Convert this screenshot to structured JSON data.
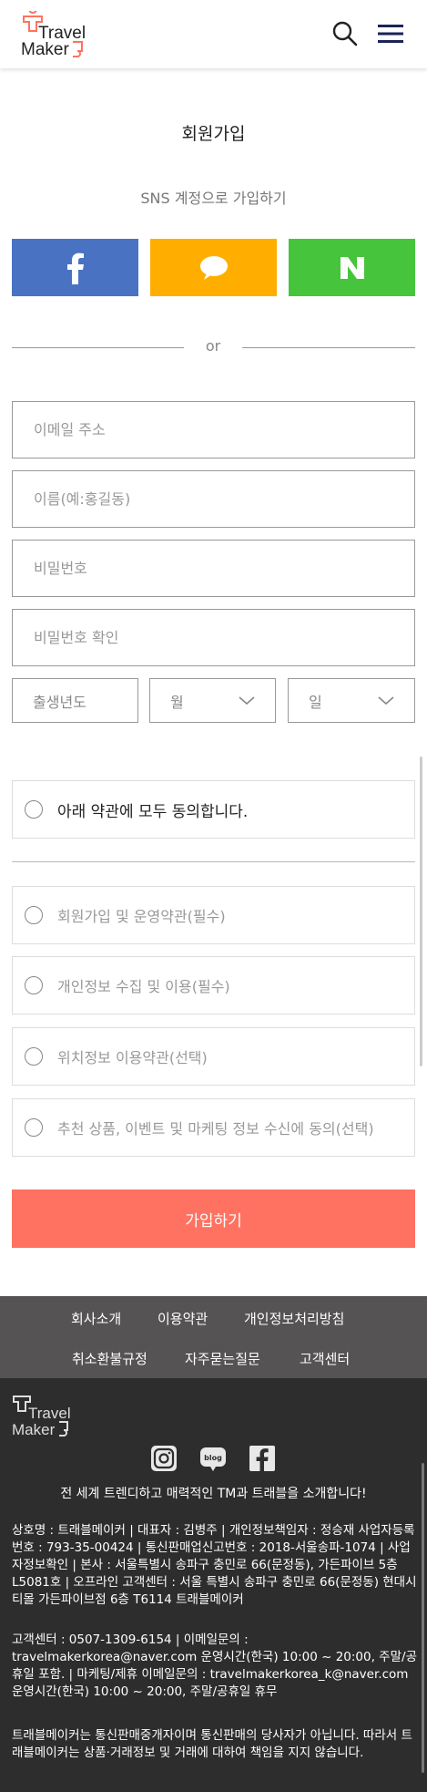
{
  "header": {
    "logo_line1": "Travel",
    "logo_line2": "Maker",
    "icons": {
      "search": "search-icon",
      "menu": "hamburger-menu-icon"
    },
    "colors": {
      "logo_text": "#222222",
      "logo_accent": "#ff7261"
    }
  },
  "page": {
    "title": "회원가입",
    "sns_title": "SNS 계정으로 가입하기",
    "or": "or"
  },
  "sns": {
    "facebook": {
      "icon": "facebook-icon",
      "color": "#4a72c2"
    },
    "kakao": {
      "icon": "kakao-chat-icon",
      "color": "#ffae00"
    },
    "naver": {
      "icon": "naver-icon",
      "color": "#46c43b"
    }
  },
  "form": {
    "email_placeholder": "이메일 주소",
    "name_placeholder": "이름(예:홍길동)",
    "password_placeholder": "비밀번호",
    "password_confirm_placeholder": "비밀번호 확인",
    "birth_year_placeholder": "출생년도",
    "month_label": "월",
    "day_label": "일"
  },
  "agreements": {
    "all": "아래 약관에 모두 동의합니다.",
    "items": [
      "회원가입 및 운영약관(필수)",
      "개인정보 수집 및 이용(필수)",
      "위치정보 이용약관(선택)",
      "추천 상품, 이벤트 및 마케팅 정보 수신에 동의(선택)"
    ]
  },
  "submit_label": "가입하기",
  "submit_color": "#ff7261",
  "footer": {
    "links": [
      "회사소개",
      "이용약관",
      "개인정보처리방침",
      "취소환불규정",
      "자주묻는질문",
      "고객센터"
    ],
    "logo_line1": "Travel",
    "logo_line2": "Maker",
    "social_icons": [
      "instagram-icon",
      "blog-icon",
      "facebook-icon"
    ],
    "blog_label": "blog",
    "tagline": "전 세계 트렌디하고 매력적인 TM과 트래블을 소개합니다!",
    "company_info": "상호명 : 트래블메이커 | 대표자 : 김병주 | 개인정보책임자 : 정승재 사업자등록번호 : 793-35-00424 | 통신판매업신고번호 : 2018-서울송파-1074 | 사업자정보확인 | 본사 : 서울특별시 송파구 충민로 66(문정동), 가든파이브 5층 L5081호 | 오프라인 고객센터 : 서울 특별시 송파구 충민로 66(문정동) 현대시티몰 가든파이브점 6층 T6114 트래블메이커",
    "contact_info": "고객센터 : 0507-1309-6154 | 이메일문의 : travelmakerkorea@naver.com 운영시간(한국) 10:00 ~ 20:00, 주말/공휴일 포함. | 마케팅/제휴 이메일문의 : travelmakerkorea_k@naver.com 운영시간(한국) 10:00 ~ 20:00, 주말/공휴일 휴무",
    "disclaimer": "트래블메이커는 통신판매중개자이며 통신판매의 당사자가 아닙니다. 따라서 트래블메이커는 상품·거래정보 및 거래에 대하여 책임을 지지 않습니다.",
    "colors": {
      "links_bg": "#555353",
      "info_bg": "#2d2d2d"
    }
  }
}
